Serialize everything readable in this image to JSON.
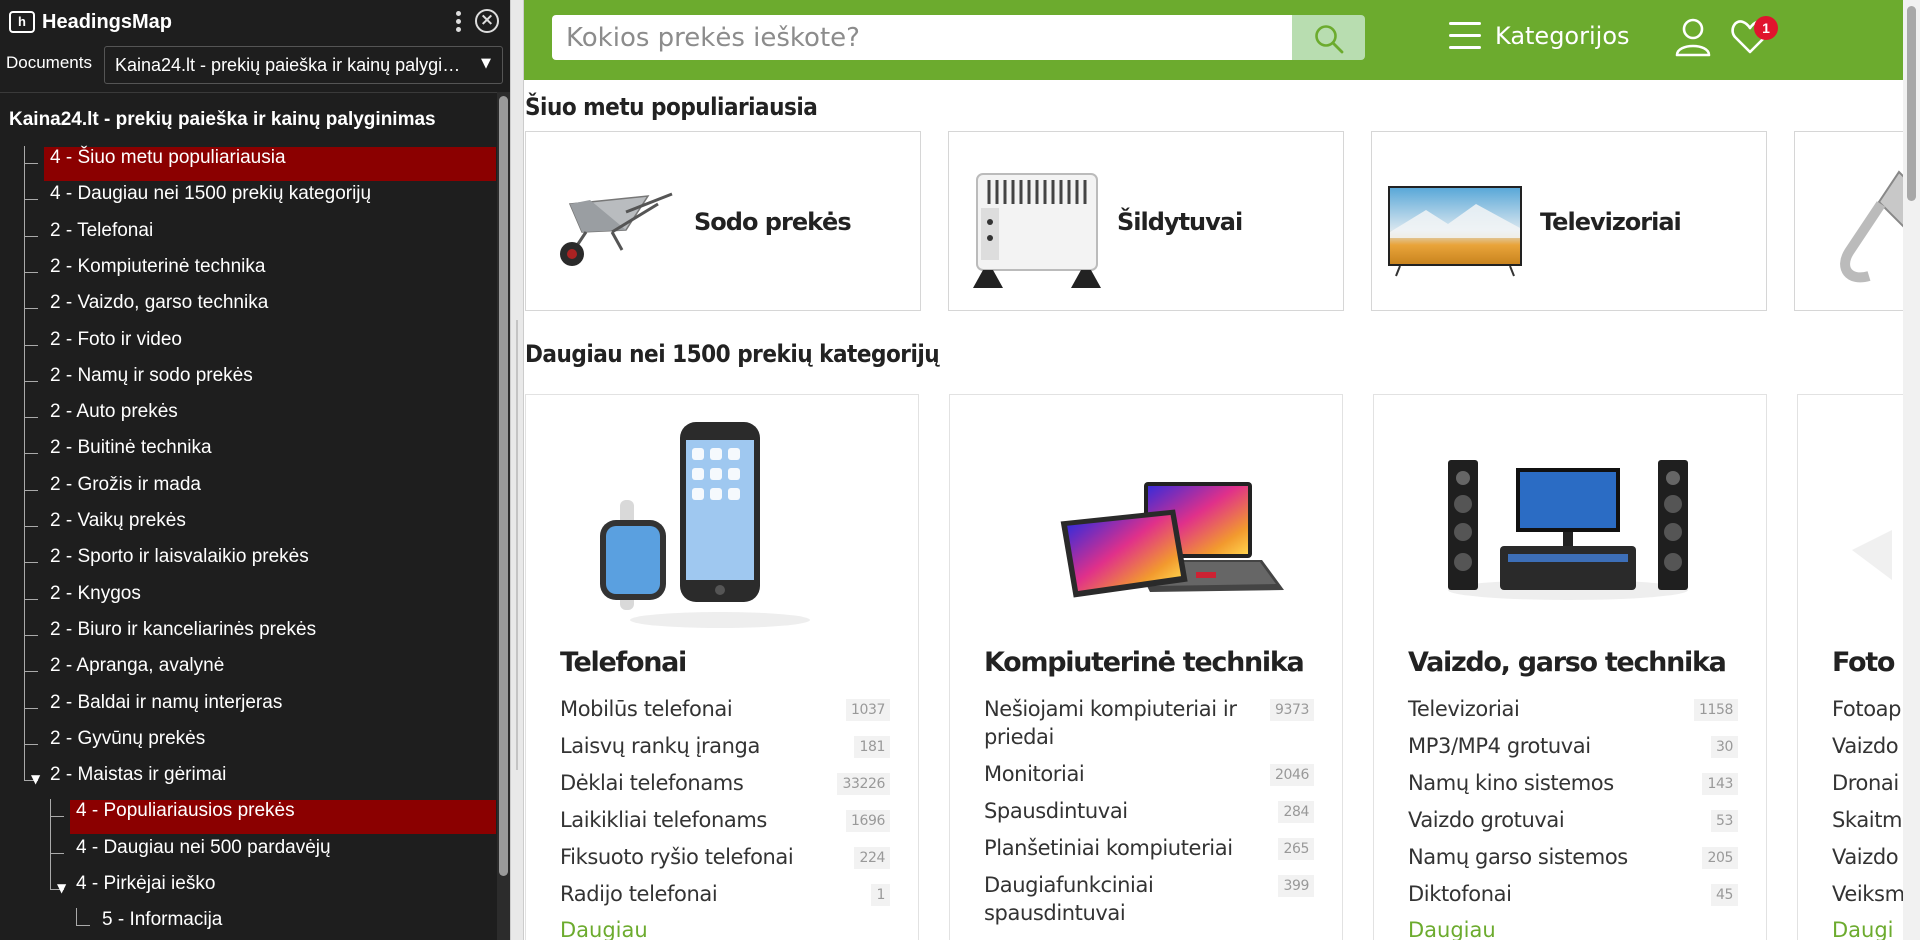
{
  "headingsmap": {
    "title": "HeadingsMap",
    "logo_text": "h",
    "documents_label": "Documents",
    "documents_value": "Kaina24.lt - prekių paieška ir kainų palyginimas",
    "doc_title": "Kaina24.lt - prekių paieška ir kainų palyginimas",
    "tree": [
      {
        "label": "4 - Šiuo metu populiariausia",
        "level": 1,
        "active": true
      },
      {
        "label": "4 - Daugiau nei 1500 prekių kategorijų",
        "level": 1
      },
      {
        "label": "2 - Telefonai",
        "level": 1
      },
      {
        "label": "2 - Kompiuterinė technika",
        "level": 1
      },
      {
        "label": "2 - Vaizdo, garso technika",
        "level": 1
      },
      {
        "label": "2 - Foto ir video",
        "level": 1
      },
      {
        "label": "2 - Namų ir sodo prekės",
        "level": 1
      },
      {
        "label": "2 - Auto prekės",
        "level": 1
      },
      {
        "label": "2 - Buitinė technika",
        "level": 1
      },
      {
        "label": "2 - Grožis ir mada",
        "level": 1
      },
      {
        "label": "2 - Vaikų prekės",
        "level": 1
      },
      {
        "label": "2 - Sporto ir laisvalaikio prekės",
        "level": 1
      },
      {
        "label": "2 - Knygos",
        "level": 1
      },
      {
        "label": "2 - Biuro ir kanceliarinės prekės",
        "level": 1
      },
      {
        "label": "2 - Apranga, avalynė",
        "level": 1
      },
      {
        "label": "2 - Baldai ir namų interjeras",
        "level": 1
      },
      {
        "label": "2 - Gyvūnų prekės",
        "level": 1
      },
      {
        "label": "2 - Maistas ir gėrimai",
        "level": 1,
        "expanded": true
      },
      {
        "label": "4 - Populiariausios prekės",
        "level": 2,
        "active": true
      },
      {
        "label": "4 - Daugiau nei 500 pardavėjų",
        "level": 2
      },
      {
        "label": "4 - Pirkėjai ieško",
        "level": 2,
        "expanded": true
      },
      {
        "label": "5 - Informacija",
        "level": 3
      }
    ]
  },
  "site": {
    "search_placeholder": "Kokios prekės ieškote?",
    "categories_label": "Kategorijos",
    "wishlist_count": "1",
    "brand_color": "#6cab2e",
    "popular_title": "Šiuo metu populiariausia",
    "popular": [
      {
        "name": "Sodo prekės",
        "icon": "wheelbarrow-icon"
      },
      {
        "name": "Šildytuvai",
        "icon": "heater-icon"
      },
      {
        "name": "Televizoriai",
        "icon": "tv-icon"
      },
      {
        "name": "",
        "icon": "plug-icon"
      }
    ],
    "categories_title": "Daugiau nei 1500 prekių kategorijų",
    "categories": [
      {
        "name": "Telefonai",
        "icon": "phone-watch-icon",
        "items": [
          {
            "label": "Mobilūs telefonai",
            "count": "1037"
          },
          {
            "label": "Laisvų rankų įranga",
            "count": "181"
          },
          {
            "label": "Dėklai telefonams",
            "count": "33226"
          },
          {
            "label": "Laikikliai telefonams",
            "count": "1696"
          },
          {
            "label": "Fiksuoto ryšio telefonai",
            "count": "224"
          },
          {
            "label": "Radijo telefonai",
            "count": "1"
          }
        ],
        "more": "Daugiau"
      },
      {
        "name": "Kompiuterinė technika",
        "icon": "laptop-tablet-icon",
        "items": [
          {
            "label": "Nešiojami kompiuteriai ir priedai",
            "count": "9373"
          },
          {
            "label": "Monitoriai",
            "count": "2046"
          },
          {
            "label": "Spausdintuvai",
            "count": "284"
          },
          {
            "label": "Planšetiniai kompiuteriai",
            "count": "265"
          },
          {
            "label": "Daugiafunkciniai spausdintuvai",
            "count": "399"
          }
        ],
        "more": ""
      },
      {
        "name": "Vaizdo, garso technika",
        "icon": "home-theater-icon",
        "items": [
          {
            "label": "Televizoriai",
            "count": "1158"
          },
          {
            "label": "MP3/MP4 grotuvai",
            "count": "30"
          },
          {
            "label": "Namų kino sistemos",
            "count": "143"
          },
          {
            "label": "Vaizdo grotuvai",
            "count": "53"
          },
          {
            "label": "Namų garso sistemos",
            "count": "205"
          },
          {
            "label": "Diktofonai",
            "count": "45"
          }
        ],
        "more": "Daugiau"
      },
      {
        "name": "Foto ir",
        "icon": "camera-icon",
        "items": [
          {
            "label": "Fotoap",
            "count": ""
          },
          {
            "label": "Vaizdo",
            "count": ""
          },
          {
            "label": "Dronai",
            "count": ""
          },
          {
            "label": "Skaitme",
            "count": ""
          },
          {
            "label": "Vaizdo",
            "count": ""
          },
          {
            "label": "Veiksm",
            "count": ""
          }
        ],
        "more": "Daugi"
      }
    ]
  }
}
